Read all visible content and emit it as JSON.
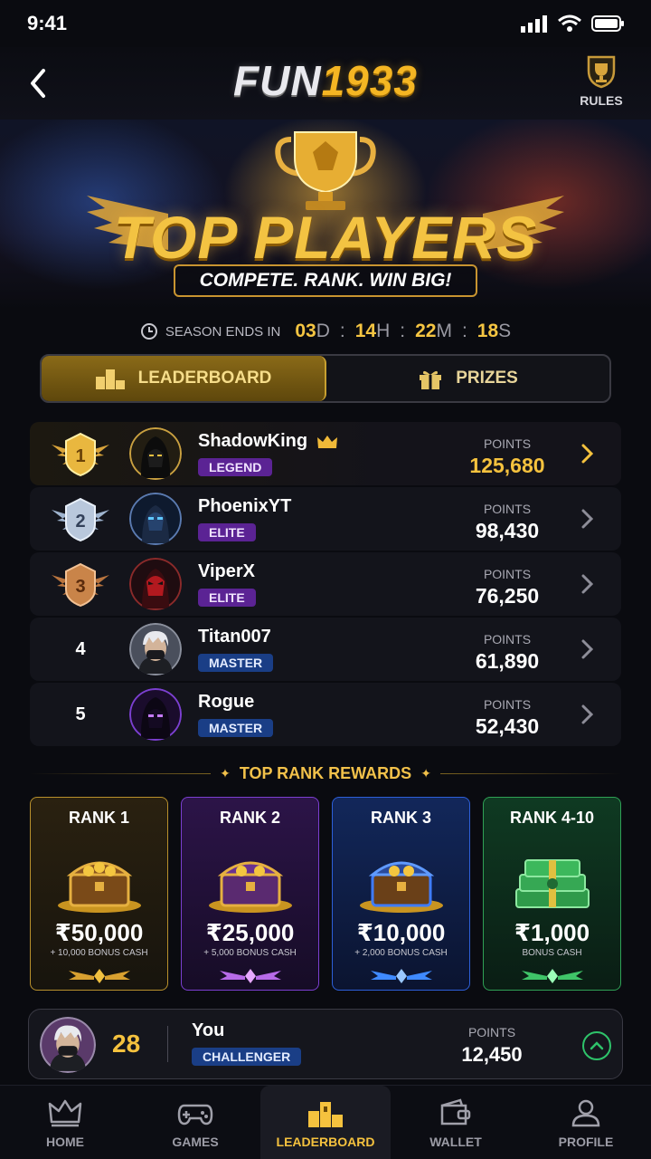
{
  "status": {
    "time": "9:41"
  },
  "header": {
    "logo_part1": "FUN",
    "logo_part2": "1933",
    "rules_label": "RULES"
  },
  "hero": {
    "title": "TOP PLAYERS",
    "tagline": "COMPETE. RANK. WIN BIG!"
  },
  "season": {
    "label": "SEASON ENDS IN",
    "days": "03",
    "hours": "14",
    "minutes": "22",
    "seconds": "18",
    "d_unit": "D",
    "h_unit": "H",
    "m_unit": "M",
    "s_unit": "S",
    "sep": ":"
  },
  "tabs": [
    {
      "label": "LEADERBOARD",
      "active": true
    },
    {
      "label": "PRIZES",
      "active": false
    }
  ],
  "leaderboard": {
    "points_label": "POINTS",
    "rows": [
      {
        "rank": "1",
        "name": "ShadowKing",
        "badge": "LEGEND",
        "points": "125,680"
      },
      {
        "rank": "2",
        "name": "PhoenixYT",
        "badge": "ELITE",
        "points": "98,430"
      },
      {
        "rank": "3",
        "name": "ViperX",
        "badge": "ELITE",
        "points": "76,250"
      },
      {
        "rank": "4",
        "name": "Titan007",
        "badge": "MASTER",
        "points": "61,890"
      },
      {
        "rank": "5",
        "name": "Rogue",
        "badge": "MASTER",
        "points": "52,430"
      }
    ]
  },
  "rewards": {
    "heading": "TOP RANK REWARDS",
    "cards": [
      {
        "title": "RANK 1",
        "amount": "₹50,000",
        "sub": "+ 10,000 BONUS CASH"
      },
      {
        "title": "RANK 2",
        "amount": "₹25,000",
        "sub": "+ 5,000 BONUS CASH"
      },
      {
        "title": "RANK 3",
        "amount": "₹10,000",
        "sub": "+ 2,000 BONUS CASH"
      },
      {
        "title": "RANK 4-10",
        "amount": "₹1,000",
        "sub": "BONUS CASH"
      }
    ]
  },
  "you": {
    "rank": "28",
    "name": "You",
    "badge": "CHALLENGER",
    "points_label": "POINTS",
    "points": "12,450"
  },
  "nav": [
    {
      "label": "HOME",
      "icon": "crown-icon"
    },
    {
      "label": "GAMES",
      "icon": "gamepad-icon"
    },
    {
      "label": "LEADERBOARD",
      "icon": "podium-icon",
      "active": true
    },
    {
      "label": "WALLET",
      "icon": "wallet-icon"
    },
    {
      "label": "PROFILE",
      "icon": "user-icon"
    }
  ],
  "colors": {
    "gold": "#f5c23e",
    "legend_badge": "#5b2394",
    "master_badge": "#1a3e86",
    "up_green": "#2ec36a"
  }
}
